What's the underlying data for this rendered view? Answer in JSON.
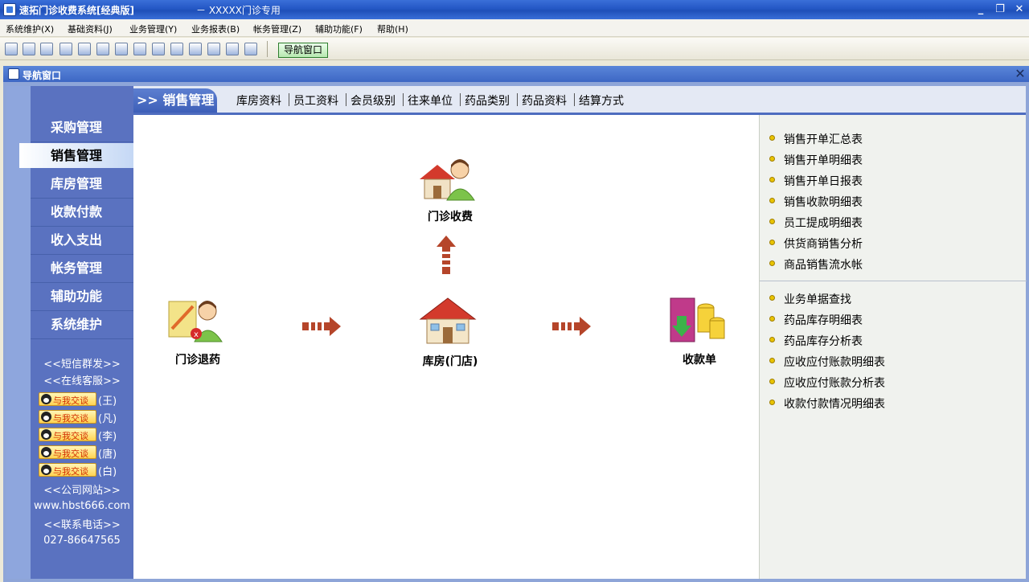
{
  "window": {
    "title": "速拓门诊收费系统[经典版]",
    "subtitle": "－ XXXXX门诊专用",
    "minimize": "_",
    "restore": "❐",
    "close": "✕"
  },
  "menu": [
    "系统维护(X)",
    "基础资料(J)",
    "业务管理(Y)",
    "业务报表(B)",
    "帐务管理(Z)",
    "辅助功能(F)",
    "帮助(H)"
  ],
  "toolbar": {
    "nav_window_label": "导航窗口",
    "icon_count": 17
  },
  "child_window": {
    "title": "导航窗口",
    "close": "✕"
  },
  "sidebar": {
    "items": [
      {
        "label": "采购管理",
        "active": false
      },
      {
        "label": "销售管理",
        "active": true
      },
      {
        "label": "库房管理",
        "active": false
      },
      {
        "label": "收款付款",
        "active": false
      },
      {
        "label": "收入支出",
        "active": false
      },
      {
        "label": "帐务管理",
        "active": false
      },
      {
        "label": "辅助功能",
        "active": false
      },
      {
        "label": "系统维护",
        "active": false
      }
    ],
    "sms": "<<短信群发>>",
    "online_service": "<<在线客服>>",
    "qq_badge_text": "与我交谈",
    "qq_contacts": [
      "(王)",
      "(凡)",
      "(李)",
      "(唐)",
      "(白)"
    ],
    "website_label": "<<公司网站>>",
    "website": "www.hbst666.com",
    "phone_label": "<<联系电话>>",
    "phone": "027-86647565"
  },
  "tabbar": {
    "active": ">> 销售管理",
    "tabs": [
      "库房资料",
      "员工资料",
      "会员级别",
      "往来单位",
      "药品类别",
      "药品资料",
      "结算方式"
    ]
  },
  "flow": {
    "top": "门诊收费",
    "left": "门诊退药",
    "center": "库房(门店)",
    "right": "收款单"
  },
  "reports": {
    "group1": [
      "销售开单汇总表",
      "销售开单明细表",
      "销售开单日报表",
      "销售收款明细表",
      "员工提成明细表",
      "供货商销售分析",
      "商品销售流水帐"
    ],
    "group2": [
      "业务单据查找",
      "药品库存明细表",
      "药品库存分析表",
      "应收应付账款明细表",
      "应收应付账款分析表",
      "收款付款情况明细表"
    ]
  }
}
